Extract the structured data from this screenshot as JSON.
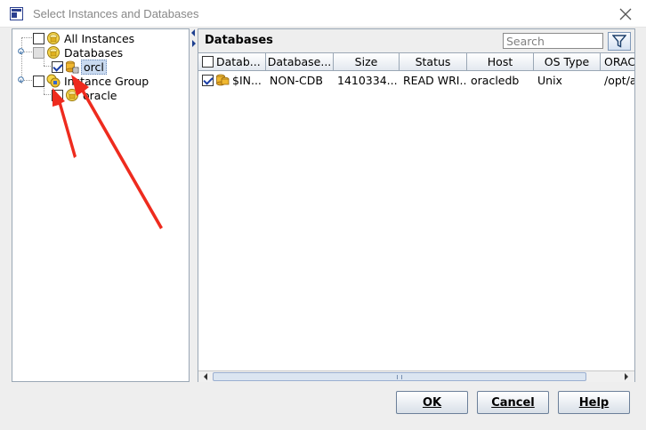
{
  "window": {
    "title": "Select Instances and Databases"
  },
  "tree": {
    "items": [
      {
        "label": "All Instances",
        "checked": false,
        "icon": "instances-icon"
      },
      {
        "label": "Databases",
        "checked": false,
        "icon": "databases-icon"
      },
      {
        "label": "orcl",
        "checked": true,
        "selected": true,
        "icon": "database-icon"
      },
      {
        "label": "Instance Group",
        "checked": false,
        "icon": "instance-group-icon"
      },
      {
        "label": "oracle",
        "checked": false,
        "icon": "instance-icon"
      }
    ]
  },
  "databases_panel": {
    "title": "Databases",
    "search_placeholder": "Search",
    "columns": [
      "Datab...",
      "Database...",
      "Size",
      "Status",
      "Host",
      "OS Type",
      "ORAC"
    ],
    "rows": [
      {
        "checked": true,
        "name": "$IN...",
        "type": "NON-CDB",
        "size": "1410334...",
        "status": "READ WRI...",
        "host": "oracledb",
        "os_type": "Unix",
        "oracle_home": "/opt/a"
      }
    ]
  },
  "buttons": {
    "ok": "OK",
    "cancel": "Cancel",
    "help": "Help"
  },
  "colors": {
    "annotation_arrow": "#ee2b1e",
    "selection": "#c9daf0",
    "checkmark": "#1a3ea6"
  }
}
